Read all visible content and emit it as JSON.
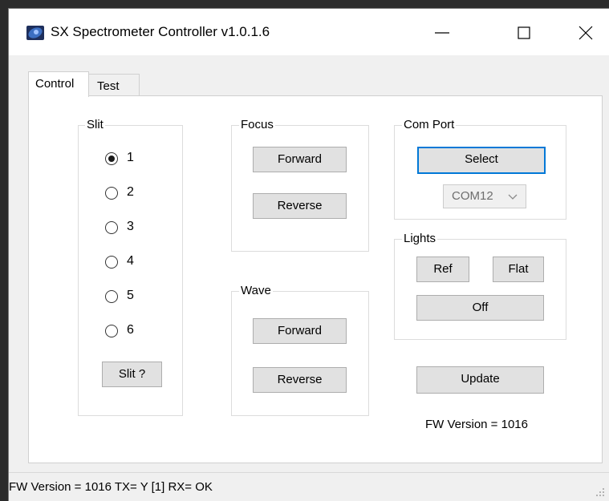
{
  "window": {
    "title": "SX Spectrometer Controller  v1.0.1.6",
    "app_icon": "spectrometer-app-icon",
    "controls": {
      "minimize": "minimize-icon",
      "maximize": "maximize-icon",
      "close": "close-icon"
    }
  },
  "tabs": [
    {
      "label": "Control",
      "selected": true
    },
    {
      "label": "Test",
      "selected": false
    }
  ],
  "slit": {
    "group_label": "Slit",
    "options": [
      {
        "label": "1",
        "checked": true
      },
      {
        "label": "2",
        "checked": false
      },
      {
        "label": "3",
        "checked": false
      },
      {
        "label": "4",
        "checked": false
      },
      {
        "label": "5",
        "checked": false
      },
      {
        "label": "6",
        "checked": false
      }
    ],
    "query_button": "Slit ?"
  },
  "focus": {
    "group_label": "Focus",
    "forward_button": "Forward",
    "reverse_button": "Reverse"
  },
  "wave": {
    "group_label": "Wave",
    "forward_button": "Forward",
    "reverse_button": "Reverse"
  },
  "com_port": {
    "group_label": "Com Port",
    "select_button": "Select",
    "selected_port": "COM12"
  },
  "lights": {
    "group_label": "Lights",
    "ref_button": "Ref",
    "flat_button": "Flat",
    "off_button": "Off"
  },
  "update_button": "Update",
  "fw_version_label": "FW Version = 1016",
  "status_bar": {
    "text": "FW Version = 1016  TX= Y [1]  RX= OK"
  },
  "colors": {
    "focus_border": "#0078d7",
    "button_face": "#e1e1e1",
    "panel": "#ffffff",
    "window": "#f0f0f0"
  }
}
